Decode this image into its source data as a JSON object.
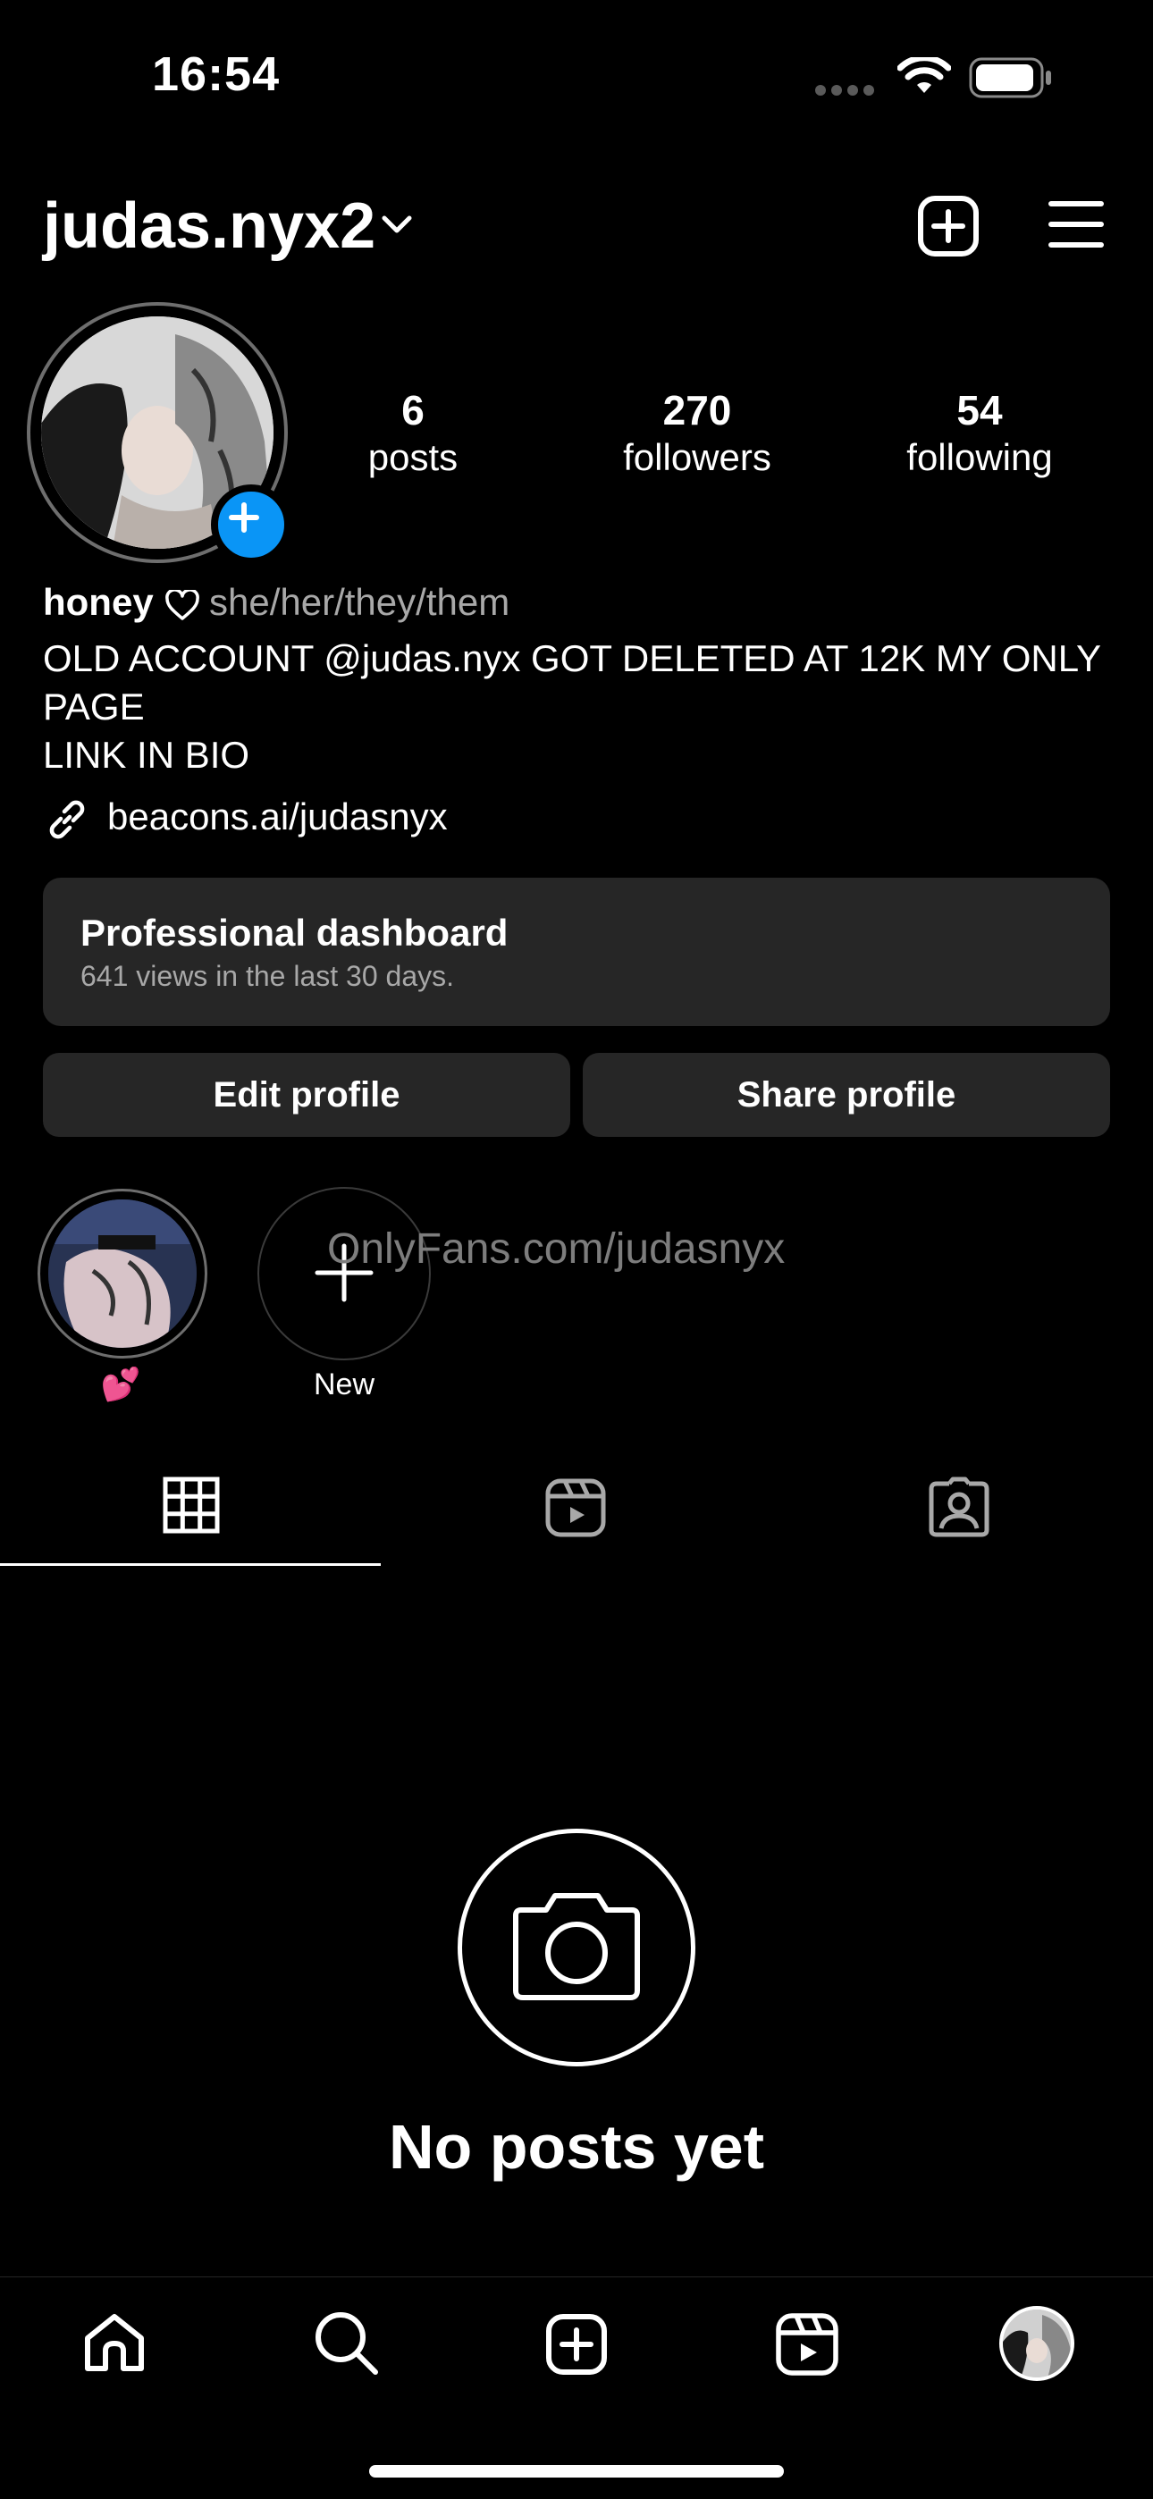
{
  "status_bar": {
    "time": "16:54"
  },
  "header": {
    "username": "judas.nyx2"
  },
  "stats": [
    {
      "value": "6",
      "label": "posts"
    },
    {
      "value": "270",
      "label": "followers"
    },
    {
      "value": "54",
      "label": "following"
    }
  ],
  "bio": {
    "name": "honey",
    "pronouns": "she/her/they/them",
    "line1": "OLD ACCOUNT @judas.nyx GOT DELETED AT 12K MY ONLY",
    "line2": "PAGE",
    "line3": "LINK IN BIO",
    "link": "beacons.ai/judasnyx"
  },
  "dashboard": {
    "title": "Professional dashboard",
    "subtitle": "641 views in the last 30 days."
  },
  "buttons": {
    "edit": "Edit profile",
    "share": "Share profile"
  },
  "highlights": [
    {
      "label": "💕"
    },
    {
      "label": "New"
    }
  ],
  "watermark": "OnlyFans.com/judasnyx",
  "empty_state": {
    "text": "No posts yet"
  },
  "colors": {
    "background": "#000000",
    "accent": "#0a95f6",
    "card": "#262626"
  }
}
